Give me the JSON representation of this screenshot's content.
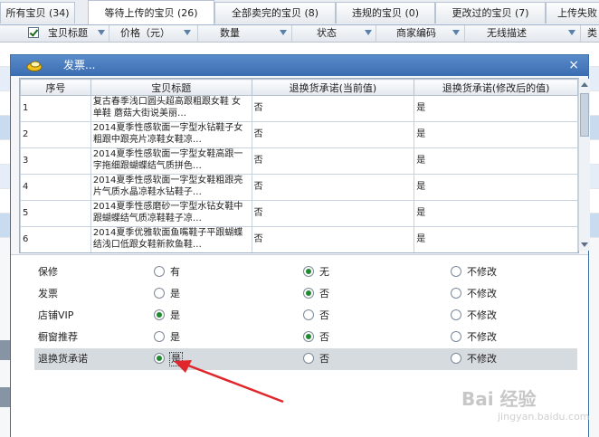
{
  "tabs": [
    {
      "label": "所有宝贝 (34)"
    },
    {
      "label": "等待上传的宝贝 (26)"
    },
    {
      "label": "全部卖完的宝贝 (8)"
    },
    {
      "label": "违规的宝贝 (0)"
    },
    {
      "label": "更改过的宝贝 (7)"
    },
    {
      "label": "上传失败"
    }
  ],
  "list_headers": [
    "宝贝标题",
    "价格（元）",
    "数量",
    "状态",
    "商家编码",
    "无线描述",
    "类"
  ],
  "dialog": {
    "title": "发票...",
    "close": "×",
    "columns": [
      "序号",
      "宝贝标题",
      "退换货承诺(当前值)",
      "退换货承诺(修改后的值)"
    ],
    "rows": [
      {
        "no": "1",
        "title": "复古春季浅口圆头超高跟粗跟女鞋 女 单鞋 蘑菇大街说美丽…",
        "current": "否",
        "new": "是"
      },
      {
        "no": "2",
        "title": "2014夏季性感软面一字型水钻鞋子女粗跟中跟亮片凉鞋女鞋凉…",
        "current": "否",
        "new": "是"
      },
      {
        "no": "3",
        "title": "2014夏季性感软面一字型女鞋高跟一字拖细跟蝴蝶结气质拼色…",
        "current": "否",
        "new": "是"
      },
      {
        "no": "4",
        "title": "2014夏季性感软面一字型女鞋粗跟亮片气质水晶凉鞋水钻鞋子…",
        "current": "否",
        "new": "是"
      },
      {
        "no": "5",
        "title": "2014夏季性感磨砂一字型水钻女鞋中跟蝴蝶结气质凉鞋鞋子凉…",
        "current": "否",
        "new": "是"
      },
      {
        "no": "6",
        "title": "2014夏季优雅软面鱼嘴鞋子平跟蝴蝶结浅口低跟女鞋新款鱼鞋…",
        "current": "否",
        "new": "是"
      }
    ],
    "options": [
      {
        "label": "保修",
        "choices": [
          "有",
          "无",
          "不修改"
        ],
        "selected": 1
      },
      {
        "label": "发票",
        "choices": [
          "是",
          "否",
          "不修改"
        ],
        "selected": 1
      },
      {
        "label": "店铺VIP",
        "choices": [
          "是",
          "否",
          "不修改"
        ],
        "selected": 0
      },
      {
        "label": "橱窗推荐",
        "choices": [
          "是",
          "否",
          "不修改"
        ],
        "selected": 1
      },
      {
        "label": "退换货承诺",
        "choices": [
          "是",
          "否",
          "不修改"
        ],
        "selected": 0
      }
    ]
  },
  "watermark": {
    "brand": "Bai 经验",
    "url": "jingyan.baidu.com"
  },
  "colors": {
    "accent": "#3a6cb0",
    "arrow": "#e0262b",
    "radio_on": "#1f8a2f"
  }
}
